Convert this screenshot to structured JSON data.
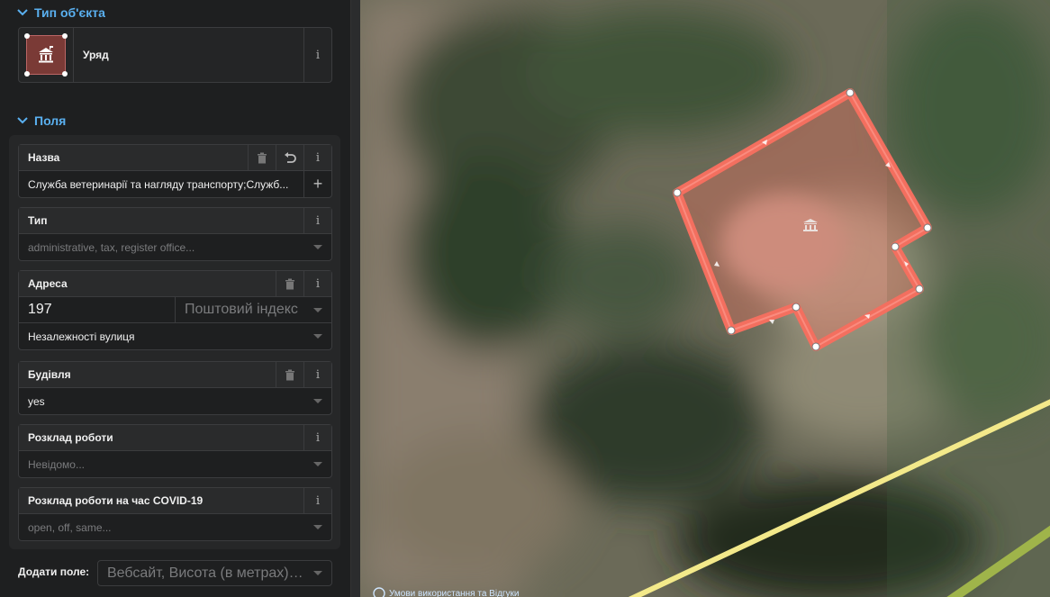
{
  "sidebar": {
    "preset_section_title": "Тип об'єкта",
    "preset": {
      "name": "Уряд",
      "icon": "government-icon"
    },
    "fields_section_title": "Поля",
    "fields": {
      "name": {
        "label": "Назва",
        "value": "Служба ветеринарії та нагляду транспорту;Служб..."
      },
      "type": {
        "label": "Тип",
        "placeholder": "administrative, tax, register office..."
      },
      "address": {
        "label": "Адреса",
        "housenumber": "197",
        "postcode_placeholder": "Поштовий індекс",
        "street": "Незалежності вулиця"
      },
      "building": {
        "label": "Будівля",
        "value": "yes"
      },
      "opening_hours": {
        "label": "Розклад роботи",
        "placeholder": "Невідомо..."
      },
      "covid_hours": {
        "label": "Розклад роботи на час COVID-19",
        "placeholder": "open, off, same..."
      }
    },
    "add_field": {
      "label": "Додати поле:",
      "placeholder": "Вебсайт, Висота (в метрах), Висота над ..."
    }
  },
  "map": {
    "attribution": "Умови використання та Відгуки",
    "selected_feature_color": "#f36f5f",
    "road_color": "#f3e98a"
  },
  "icons": {
    "info": "i",
    "delete": "trash-icon",
    "revert": "undo-icon",
    "add": "+"
  }
}
